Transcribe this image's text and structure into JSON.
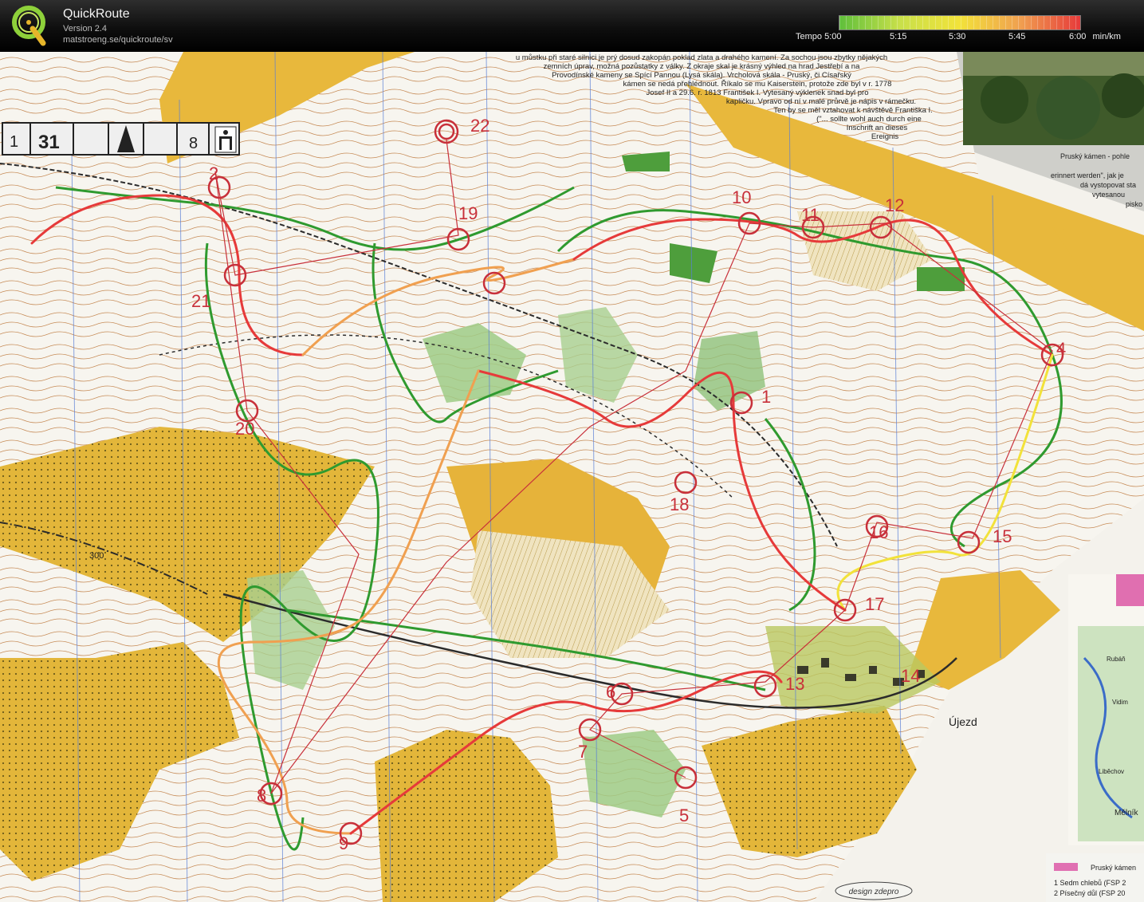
{
  "app": {
    "name": "QuickRoute",
    "version": "Version 2.4",
    "url": "matstroeng.se/quickroute/sv"
  },
  "tempo_legend": {
    "label": "Tempo",
    "ticks": [
      "5:00",
      "5:15",
      "5:30",
      "5:45",
      "6:00"
    ],
    "unit": "min/km",
    "colors": [
      "#5fbf3b",
      "#c8e04a",
      "#f2e23a",
      "#f0a050",
      "#e63a3a"
    ]
  },
  "map": {
    "controls": [
      "1",
      "2",
      "4",
      "5",
      "6",
      "7",
      "8",
      "9",
      "10",
      "11",
      "12",
      "13",
      "14",
      "15",
      "16",
      "17",
      "18",
      "19",
      "20",
      "21",
      "22"
    ],
    "start_symbol": "triangle",
    "finish_symbol": "double-circle",
    "header_strip": {
      "values": [
        "1",
        "31",
        "8"
      ]
    },
    "contour_label": "300",
    "place_label": "Újezd",
    "text_block": [
      "u můstku při staré silnici je prý dosud zakopán poklad zlata a drahého kamení. Za sochou jsou zbytky nějakých",
      "zemních úprav, možná pozůstatky z války. Z okraje skal je krásný výhled na hrad Jestřebí a na",
      "Provodínské kameny se Spící Pannou (Lysá skála). Vrcholová skála - Pruský, či Císařský",
      "kámen se nedá přehlédnout. Říkalo se mu Kaiserstein, protože zde byl v r. 1778",
      "Josef II a 29.6. r. 1813 František I. Vytesaný výklenek snad byl pro",
      "kapličku. Vpravo od ní v malé průrvě je nápis v rámečku.",
      "Ten by se měl vztahovat k návštěvě Františka I.",
      "(\"... sollte wohl auch durch eine",
      "Inschrift an dieses",
      "Ereignis"
    ],
    "photo_caption": "Pruský kámen - pohle",
    "german_block": [
      "erinnert werden\", jak je",
      "dá vystopovat sta",
      "vytesanou",
      "pisko"
    ],
    "inset_places": [
      "Rubáň",
      "Vidim",
      "Liběchov",
      "Mělník"
    ],
    "legend_box": {
      "title": "Pruský kámen",
      "items": [
        "1   Sedm chlebů (FSP 2",
        "2   Písečný důl (FSP 20"
      ]
    },
    "designer": "design zdepro"
  }
}
